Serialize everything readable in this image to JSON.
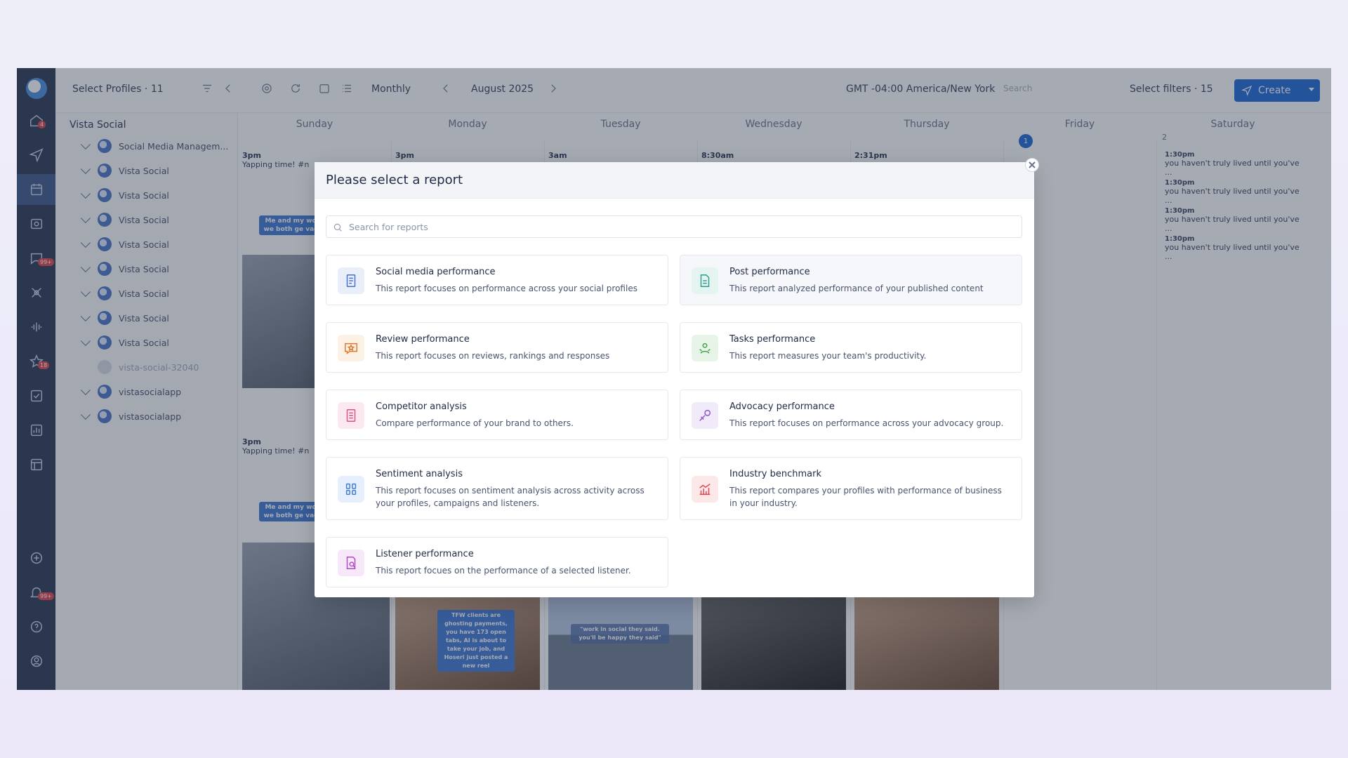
{
  "topbar": {
    "select_profiles": "Select Profiles · 11",
    "view_mode": "Monthly",
    "month": "August 2025",
    "timezone": "GMT -04:00 America/New York",
    "search_placeholder": "Search",
    "select_filters": "Select filters · 15",
    "create_label": "Create"
  },
  "profiles": {
    "group_name": "Vista Social",
    "items": [
      {
        "label": "Social Media Managem..."
      },
      {
        "label": "Vista Social"
      },
      {
        "label": "Vista Social"
      },
      {
        "label": "Vista Social"
      },
      {
        "label": "Vista Social"
      },
      {
        "label": "Vista Social"
      },
      {
        "label": "Vista Social"
      },
      {
        "label": "Vista Social"
      },
      {
        "label": "Vista Social"
      },
      {
        "label": "vista-social-32040"
      },
      {
        "label": "vistasocialapp"
      },
      {
        "label": "vistasocialapp"
      }
    ]
  },
  "calendar": {
    "days": [
      "Sunday",
      "Monday",
      "Tuesday",
      "Wednesday",
      "Thursday",
      "Friday",
      "Saturday"
    ],
    "posts_row1": [
      {
        "time": "3pm",
        "text": "Yapping time! #n"
      },
      {
        "time": "3pm",
        "text": ""
      },
      {
        "time": "3am",
        "text": ""
      },
      {
        "time": "8:30am",
        "text": ""
      },
      {
        "time": "2:31pm",
        "text": ""
      }
    ],
    "sunday_post2": {
      "time": "3pm",
      "text": "Yapping time! #n"
    },
    "chip_text": "Me and my wo we both ge vac",
    "chip2_text": "TFW clients are ghosting payments, you have 173 open tabs, AI is about to take your job, and Hoseri just posted a new reel",
    "chip3_text": "\"work in social they said. you'll be happy they said\"",
    "saturday_date": "2",
    "thursday_badge": "1",
    "saturday_posts": [
      {
        "time": "1:30pm",
        "text": "you haven't truly lived until you've ..."
      },
      {
        "time": "1:30pm",
        "text": "you haven't truly lived until you've ..."
      },
      {
        "time": "1:30pm",
        "text": "you haven't truly lived until you've ..."
      },
      {
        "time": "1:30pm",
        "text": "you haven't truly lived until you've ..."
      }
    ]
  },
  "modal": {
    "title": "Please select a report",
    "search_placeholder": "Search for reports",
    "reports": [
      {
        "title": "Social media performance",
        "desc": "This report focuses on performance across your social profiles",
        "icon": "social-report-icon",
        "color": "#4a6fd1",
        "bg": "#e9eefb"
      },
      {
        "title": "Post performance",
        "desc": "This report analyzed performance of your published content",
        "icon": "document-icon",
        "color": "#2e9d8f",
        "bg": "#e4f4f1"
      },
      {
        "title": "Review performance",
        "desc": "This report focuses on reviews, rankings and responses",
        "icon": "review-star-icon",
        "color": "#e0782c",
        "bg": "#fdf0e5"
      },
      {
        "title": "Tasks performance",
        "desc": "This report measures your team's productivity.",
        "icon": "team-icon",
        "color": "#3fa04a",
        "bg": "#e7f5e8"
      },
      {
        "title": "Competitor analysis",
        "desc": "Compare performance of your brand to others.",
        "icon": "competitor-icon",
        "color": "#e04f8a",
        "bg": "#fce8f0"
      },
      {
        "title": "Advocacy performance",
        "desc": "This report focuses on performance across your advocacy group.",
        "icon": "advocacy-icon",
        "color": "#8a56c9",
        "bg": "#f1eafa"
      },
      {
        "title": "Sentiment analysis",
        "desc": "This report focuses on sentiment analysis across activity across your profiles, campaigns and listeners.",
        "icon": "sentiment-icon",
        "color": "#3e7dd8",
        "bg": "#e6effb"
      },
      {
        "title": "Industry benchmark",
        "desc": "This report compares your profiles with performance of business in your industry.",
        "icon": "benchmark-icon",
        "color": "#e0454f",
        "bg": "#fce8e9"
      },
      {
        "title": "Listener performance",
        "desc": "This report focues on the performance of a selected listener.",
        "icon": "listener-icon",
        "color": "#b04ac4",
        "bg": "#f6e8f8"
      }
    ]
  }
}
